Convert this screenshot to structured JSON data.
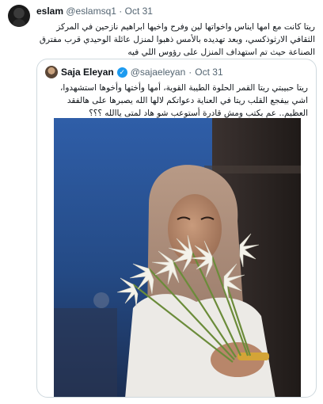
{
  "tweet": {
    "author_name": "eslam",
    "author_handle": "@eslamsq1",
    "separator": "·",
    "date": "Oct 31",
    "text": "ريتا كانت مع امها ايناس واخواتها لين وفرح واخيها ابراهيم نازحين في المركز الثقافي الارثوذكسي، وبعد تهديده بالأمس ذهبوا لمنزل عائلة الوحيدي قرب مفترق الصناعة حيث تم استهداف المنزل على رؤوس اللي فيه"
  },
  "quote": {
    "author_name": "Saja Eleyan",
    "author_handle": "@sajaeleyan",
    "separator": "·",
    "date": "Oct 31",
    "text": "ريتا حبيبتي ريتا القمر الحلوة الطيبة القوية، أمها وأختها وأخوها استشهدوا، اشي بيفجع القلب ريتا في العناية دعواتكم لالها الله يصبرها على هالفقد العظيم.. عم بكتب ومش قادرة أستوعب شو هاد لمتى ياالله ؟؟؟"
  },
  "icons": {
    "verified": "verified-badge-icon"
  },
  "colors": {
    "verified": "#1d9bf0",
    "muted": "#536471",
    "border": "#cfd9de"
  }
}
